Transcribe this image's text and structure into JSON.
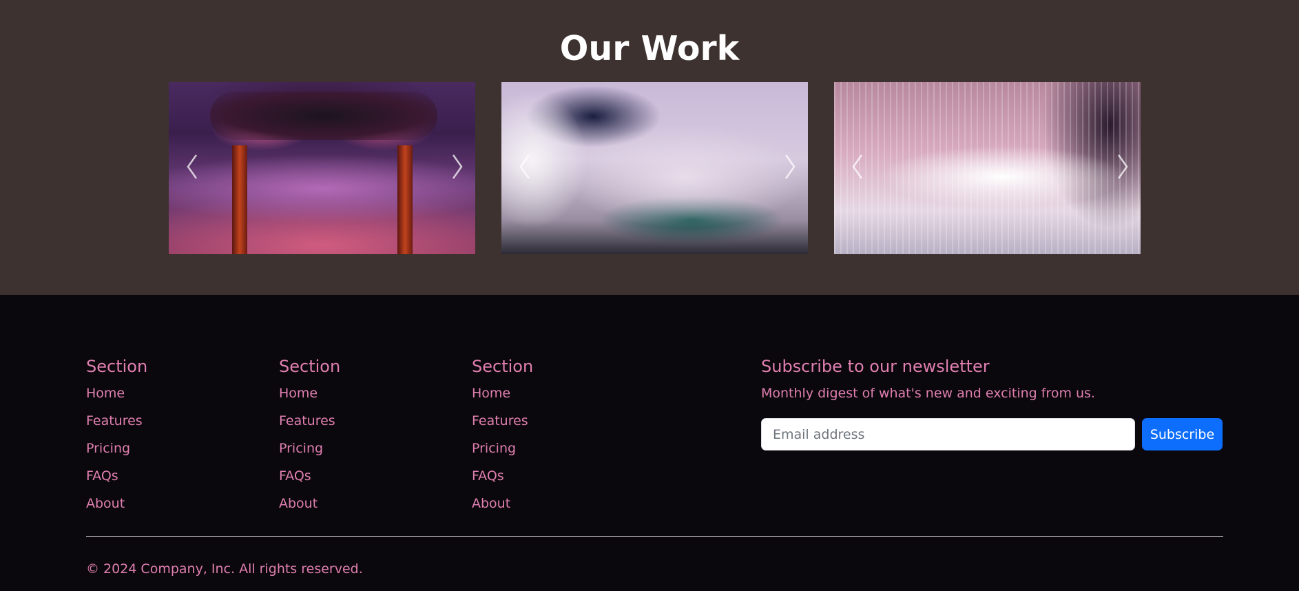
{
  "work": {
    "title": "Our Work",
    "carousels": [
      {
        "image": "floral-arch-banquet-hall-photo",
        "prev_icon": "chevron-left-icon",
        "next_icon": "chevron-right-icon"
      },
      {
        "image": "white-table-setting-photo",
        "prev_icon": "chevron-left-icon",
        "next_icon": "chevron-right-icon"
      },
      {
        "image": "long-table-white-flowers-photo",
        "prev_icon": "chevron-left-icon",
        "next_icon": "chevron-right-icon"
      }
    ]
  },
  "footer": {
    "columns": [
      {
        "heading": "Section",
        "links": [
          "Home",
          "Features",
          "Pricing",
          "FAQs",
          "About"
        ]
      },
      {
        "heading": "Section",
        "links": [
          "Home",
          "Features",
          "Pricing",
          "FAQs",
          "About"
        ]
      },
      {
        "heading": "Section",
        "links": [
          "Home",
          "Features",
          "Pricing",
          "FAQs",
          "About"
        ]
      }
    ],
    "newsletter": {
      "heading": "Subscribe to our newsletter",
      "description": "Monthly digest of what's new and exciting from us.",
      "email_placeholder": "Email address",
      "email_value": "",
      "button_label": "Subscribe"
    },
    "copyright": "© 2024 Company, Inc. All rights reserved."
  },
  "colors": {
    "work_background": "#3d322f",
    "footer_background": "#0b080d",
    "accent_pink": "#e07fb0",
    "button_blue": "#0d6efd"
  }
}
